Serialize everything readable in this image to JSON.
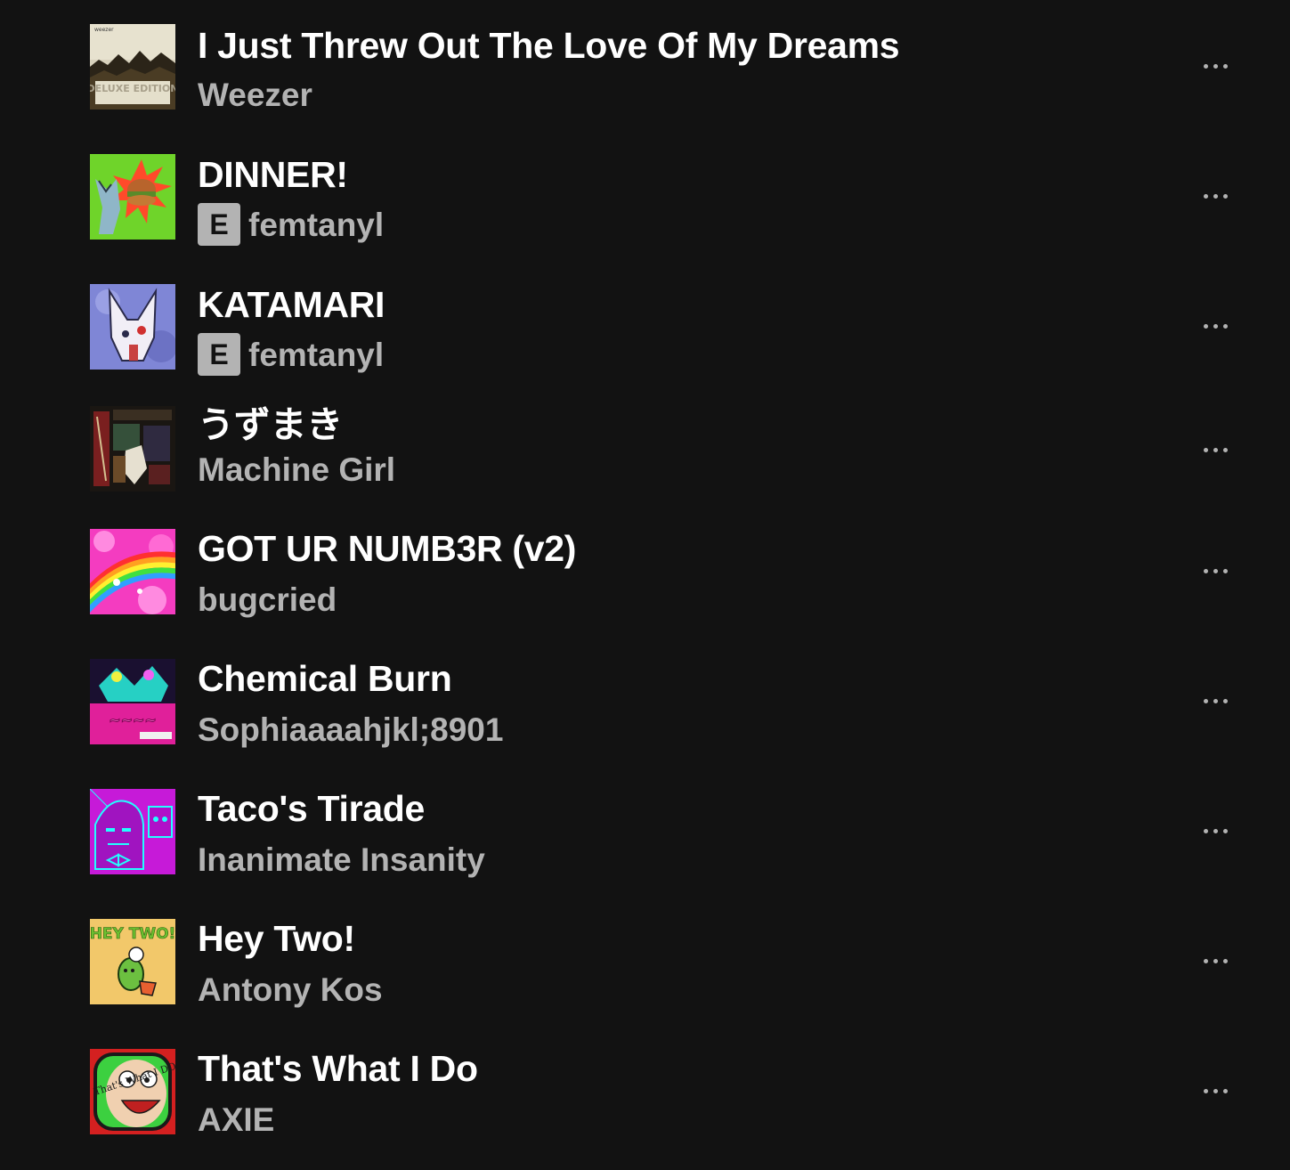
{
  "tracks": [
    {
      "title": "I Just Threw Out The Love Of My Dreams",
      "artist": "Weezer",
      "explicit": false,
      "cover_text": "DELUXE EDITION",
      "cover_top": "weezer"
    },
    {
      "title": "DINNER!",
      "artist": "femtanyl",
      "explicit": true,
      "explicit_label": "E"
    },
    {
      "title": "KATAMARI",
      "artist": "femtanyl",
      "explicit": true,
      "explicit_label": "E"
    },
    {
      "title": "うずまき",
      "artist": "Machine Girl",
      "explicit": false
    },
    {
      "title": "GOT UR NUMB3R (v2)",
      "artist": "bugcried",
      "explicit": false
    },
    {
      "title": "Chemical Burn",
      "artist": "Sophiaaaahjkl;8901",
      "explicit": false
    },
    {
      "title": "Taco's Tirade",
      "artist": "Inanimate Insanity",
      "explicit": false
    },
    {
      "title": "Hey Two!",
      "artist": "Antony Kos",
      "explicit": false,
      "cover_text": "HEY TWO!"
    },
    {
      "title": "That's What I Do",
      "artist": "AXIE",
      "explicit": false,
      "cover_text": "That's What I DO!"
    }
  ],
  "colors": {
    "background": "#121212",
    "title": "#ffffff",
    "secondary": "#b3b3b3"
  },
  "icons": {
    "more": "more-options-icon",
    "explicit": "explicit-badge"
  }
}
